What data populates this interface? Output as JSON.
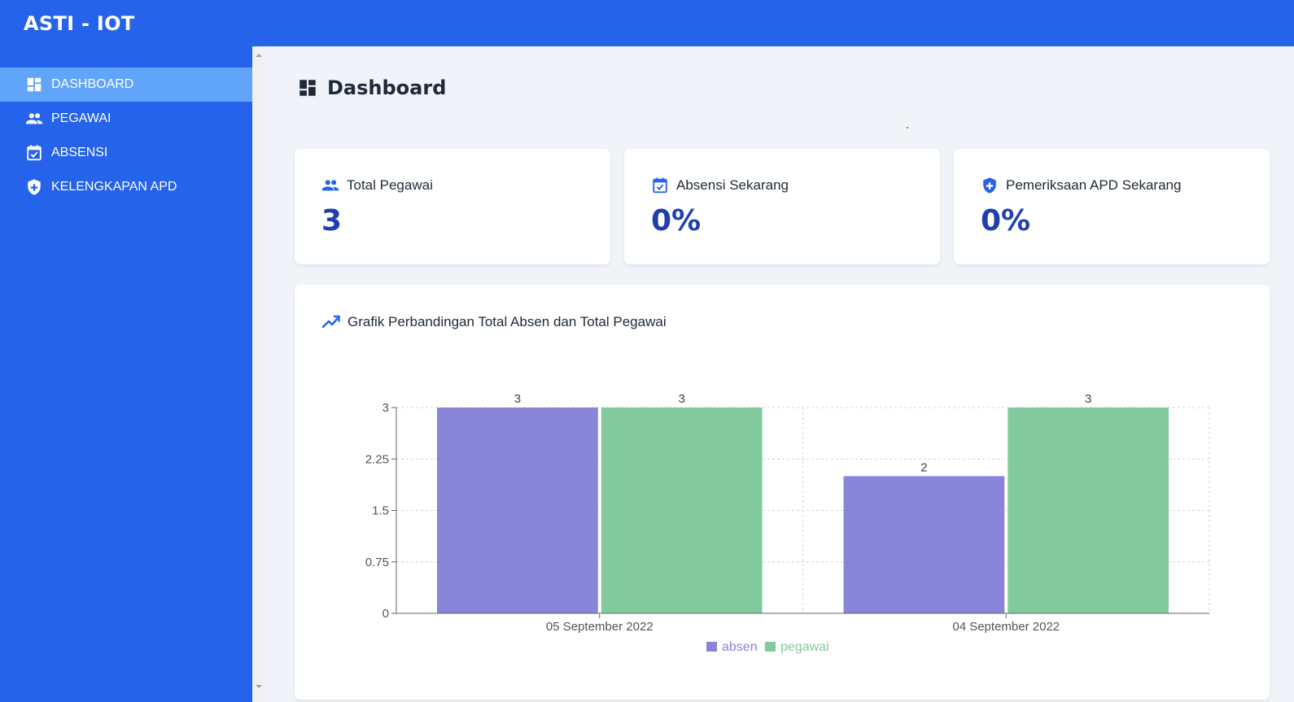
{
  "app": {
    "title": "ASTI - IOT"
  },
  "sidebar": {
    "items": [
      {
        "label": "DASHBOARD",
        "icon": "dashboard-icon",
        "active": true
      },
      {
        "label": "PEGAWAI",
        "icon": "people-icon",
        "active": false
      },
      {
        "label": "ABSENSI",
        "icon": "calendar-check-icon",
        "active": false
      },
      {
        "label": "KELENGKAPAN APD",
        "icon": "shield-plus-icon",
        "active": false
      }
    ]
  },
  "page": {
    "title": "Dashboard",
    "icon": "dashboard-icon"
  },
  "stats": [
    {
      "label": "Total Pegawai",
      "value": "3",
      "icon": "people-icon"
    },
    {
      "label": "Absensi Sekarang",
      "value": "0%",
      "icon": "calendar-check-icon"
    },
    {
      "label": "Pemeriksaan APD Sekarang",
      "value": "0%",
      "icon": "shield-plus-icon"
    }
  ],
  "chart_section": {
    "title": "Grafik Perbandingan Total Absen dan Total Pegawai",
    "icon": "trending-up-icon"
  },
  "colors": {
    "primary": "#2563eb",
    "active_nav": "#60a5fa",
    "value_text": "#1e40af",
    "absen": "#8884d8",
    "pegawai": "#82ca9d"
  },
  "chart_data": {
    "type": "bar",
    "categories": [
      "05 September 2022",
      "04 September 2022"
    ],
    "series": [
      {
        "name": "absen",
        "values": [
          3,
          2
        ],
        "color": "#8884d8"
      },
      {
        "name": "pegawai",
        "values": [
          3,
          3
        ],
        "color": "#82ca9d"
      }
    ],
    "yticks": [
      0,
      0.75,
      1.5,
      2.25,
      3
    ],
    "ytick_labels": [
      "0",
      "0.75",
      "1.5",
      "2.25",
      "3"
    ],
    "ylim": [
      0,
      3
    ],
    "grid": true,
    "legend": "bottom-center",
    "data_labels": true
  }
}
